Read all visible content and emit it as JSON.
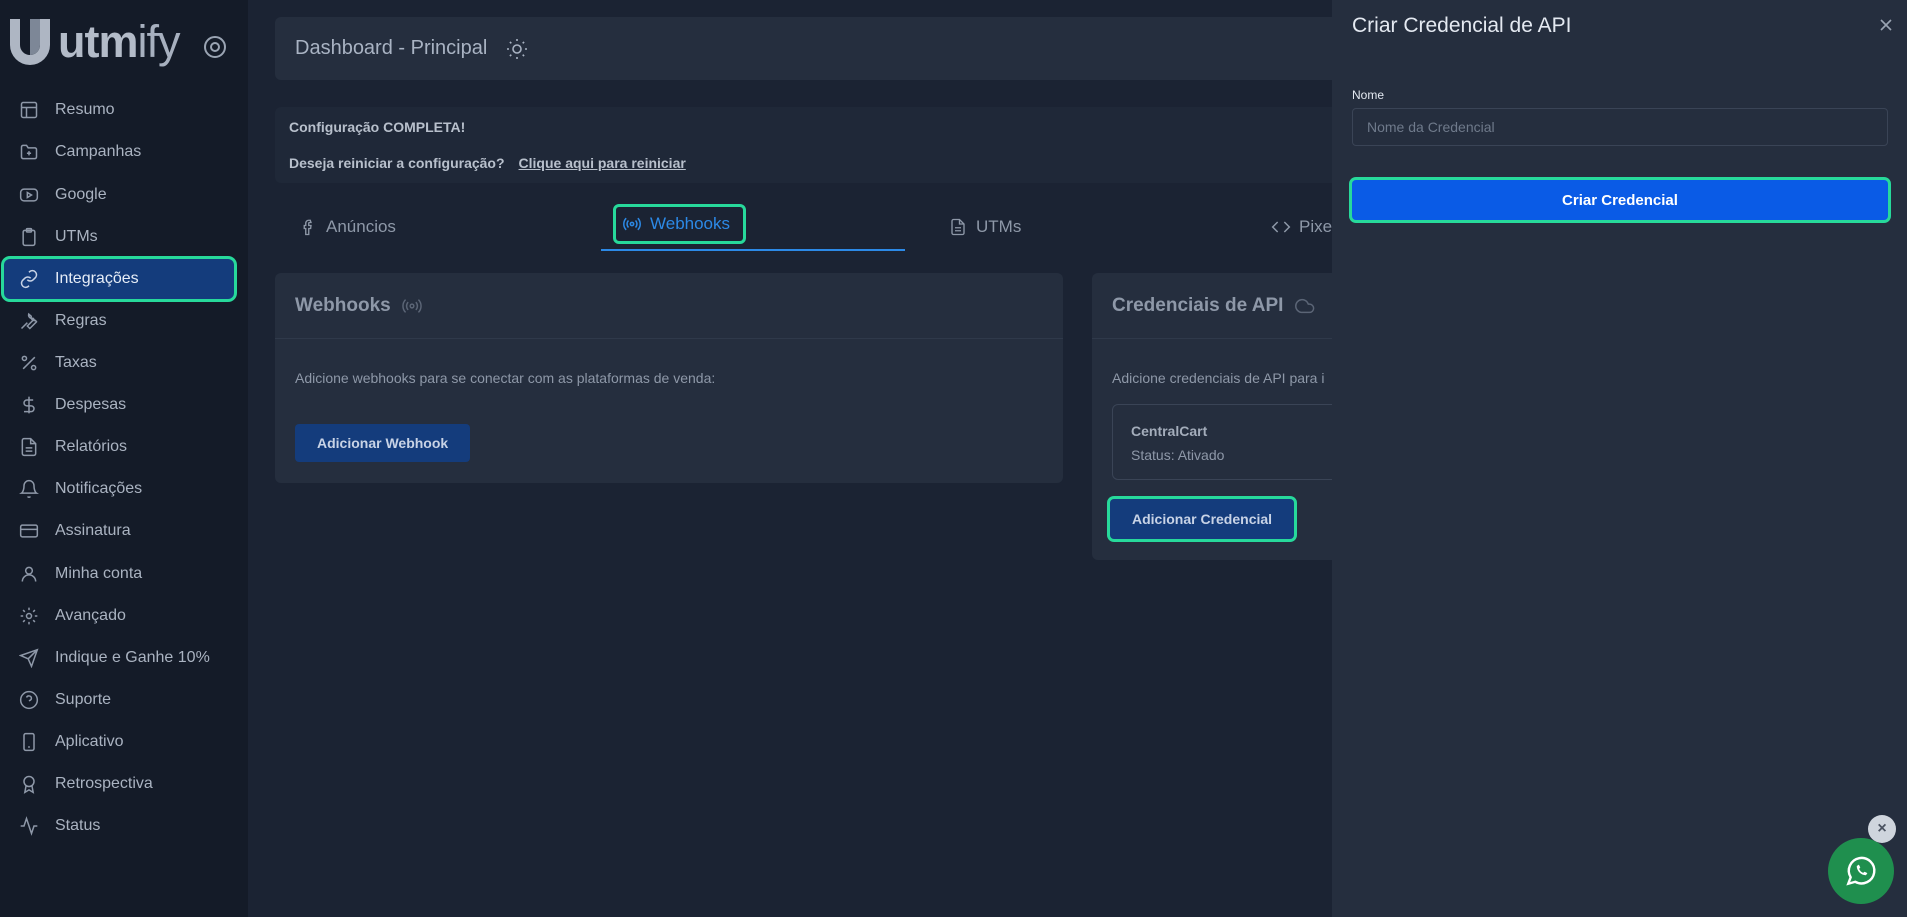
{
  "brand": {
    "name": "utmify",
    "accent": "#27d99b",
    "primary": "#0a5be6"
  },
  "sidebar": {
    "items": [
      {
        "label": "Resumo",
        "icon": "layout-icon"
      },
      {
        "label": "Campanhas",
        "icon": "folder-icon"
      },
      {
        "label": "Google",
        "icon": "youtube-icon"
      },
      {
        "label": "UTMs",
        "icon": "clipboard-icon"
      },
      {
        "label": "Integrações",
        "icon": "link-icon",
        "active": true
      },
      {
        "label": "Regras",
        "icon": "wrench-icon"
      },
      {
        "label": "Taxas",
        "icon": "percent-icon"
      },
      {
        "label": "Despesas",
        "icon": "dollar-icon"
      },
      {
        "label": "Relatórios",
        "icon": "document-icon"
      },
      {
        "label": "Notificações",
        "icon": "bell-icon"
      },
      {
        "label": "Assinatura",
        "icon": "credit-card-icon"
      },
      {
        "label": "Minha conta",
        "icon": "user-icon"
      },
      {
        "label": "Avançado",
        "icon": "gear-icon"
      },
      {
        "label": "Indique e Ganhe 10%",
        "icon": "send-icon"
      },
      {
        "label": "Suporte",
        "icon": "help-icon"
      },
      {
        "label": "Aplicativo",
        "icon": "smartphone-icon"
      },
      {
        "label": "Retrospectiva",
        "icon": "award-icon"
      },
      {
        "label": "Status",
        "icon": "activity-icon"
      }
    ]
  },
  "header": {
    "title": "Dashboard - Principal"
  },
  "config": {
    "status": "Configuração COMPLETA!",
    "question": "Deseja reiniciar a configuração?",
    "link": "Clique aqui para reiniciar"
  },
  "tabs": [
    {
      "label": "Anúncios",
      "icon": "facebook-icon"
    },
    {
      "label": "Webhooks",
      "icon": "broadcast-icon",
      "active": true
    },
    {
      "label": "UTMs",
      "icon": "file-text-icon"
    },
    {
      "label": "Pixe",
      "icon": "code-icon"
    }
  ],
  "webhooks_card": {
    "title": "Webhooks",
    "description": "Adicione webhooks para se conectar com as plataformas de venda:",
    "button": "Adicionar Webhook"
  },
  "credentials_card": {
    "title": "Credenciais de API",
    "description": "Adicione credenciais de API para i",
    "item": {
      "name": "CentralCart",
      "status": "Status: Ativado"
    },
    "button": "Adicionar Credencial"
  },
  "drawer": {
    "title": "Criar Credencial de API",
    "field_label": "Nome",
    "field_placeholder": "Nome da Credencial",
    "submit": "Criar Credencial"
  },
  "whatsapp": {
    "close": "×"
  }
}
